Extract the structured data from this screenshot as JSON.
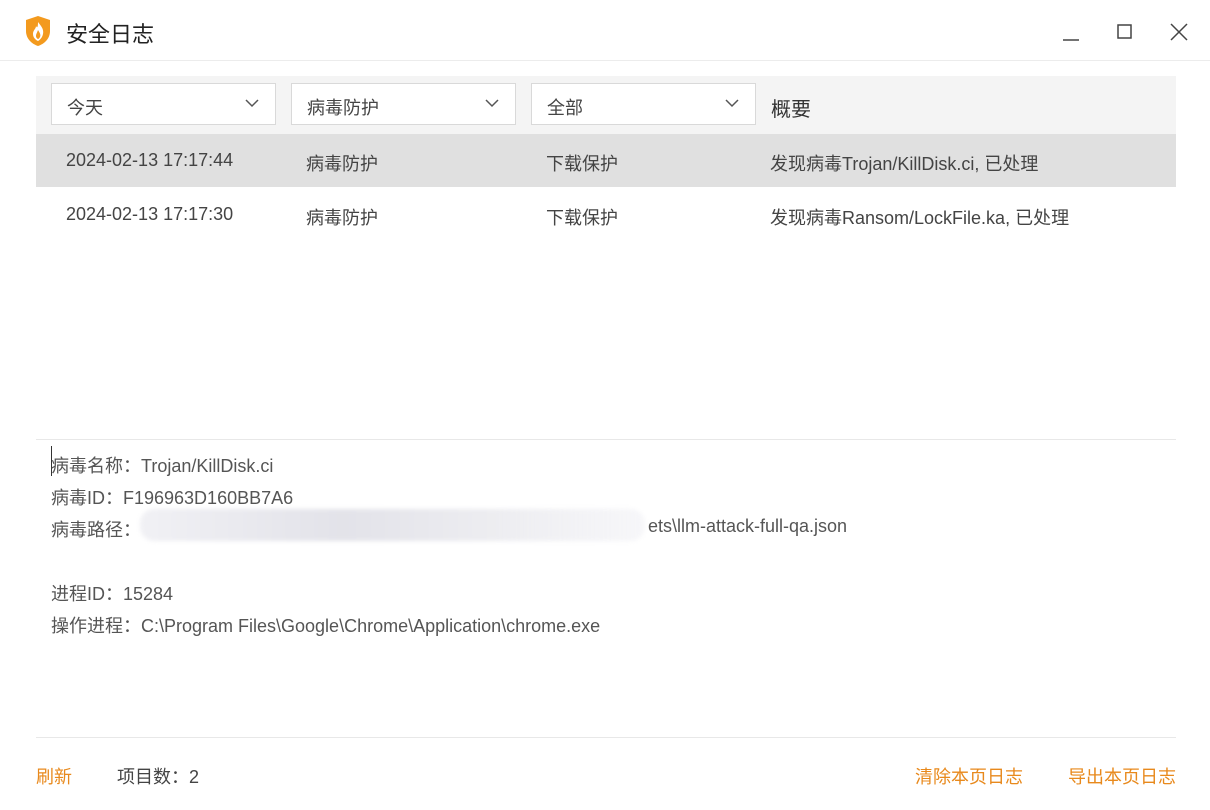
{
  "window": {
    "title": "安全日志"
  },
  "filters": {
    "date": "今天",
    "category": "病毒防护",
    "type": "全部",
    "summary_header": "概要"
  },
  "rows": [
    {
      "time": "2024-02-13 17:17:44",
      "category": "病毒防护",
      "type": "下载保护",
      "summary": "发现病毒Trojan/KillDisk.ci, 已处理"
    },
    {
      "time": "2024-02-13 17:17:30",
      "category": "病毒防护",
      "type": "下载保护",
      "summary": "发现病毒Ransom/LockFile.ka, 已处理"
    }
  ],
  "details": {
    "virus_name": "病毒名称：Trojan/KillDisk.ci",
    "virus_id": "病毒ID：F196963D160BB7A6",
    "virus_path": "病毒路径：",
    "virus_path_visible_tail": "ets\\llm-attack-full-qa.json",
    "process_id": "进程ID：15284",
    "process": "操作进程：C:\\Program Files\\Google\\Chrome\\Application\\chrome.exe"
  },
  "footer": {
    "refresh": "刷新",
    "item_count": "项目数：2",
    "clear_page_log": "清除本页日志",
    "export_page_log": "导出本页日志"
  },
  "colors": {
    "accent": "#e8891c",
    "selected_row": "#e0e0e0"
  }
}
